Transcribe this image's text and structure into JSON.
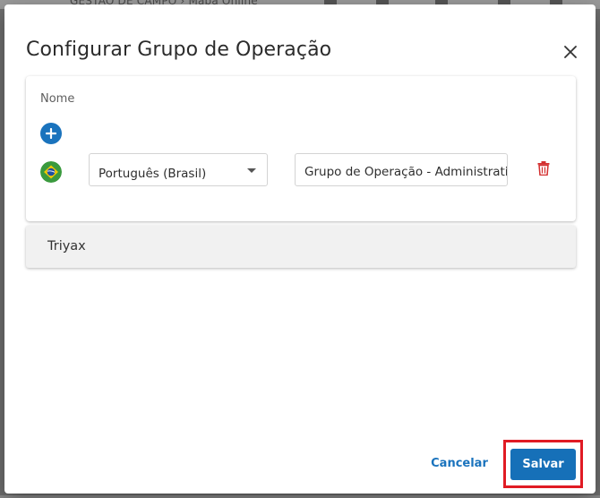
{
  "background": {
    "breadcrumb": "GESTÃO DE CAMPO  ›  Mapa Online"
  },
  "dialog": {
    "title": "Configurar Grupo de Operação",
    "name_section": {
      "label": "Nome",
      "language_select": {
        "selected": "Português (Brasil)"
      },
      "name_input": {
        "value": "Grupo de Operação - Administrativo"
      }
    },
    "panels": [
      {
        "label": "Triyax"
      }
    ],
    "footer": {
      "cancel_label": "Cancelar",
      "save_label": "Salvar"
    }
  },
  "colors": {
    "primary": "#1670b8",
    "danger": "#d32f2f",
    "highlight": "#e01b24"
  },
  "icons": {
    "close": "close-icon",
    "add": "plus-icon",
    "flag": "brazil-flag-icon",
    "delete": "trash-icon",
    "dropdown": "caret-down-icon"
  }
}
